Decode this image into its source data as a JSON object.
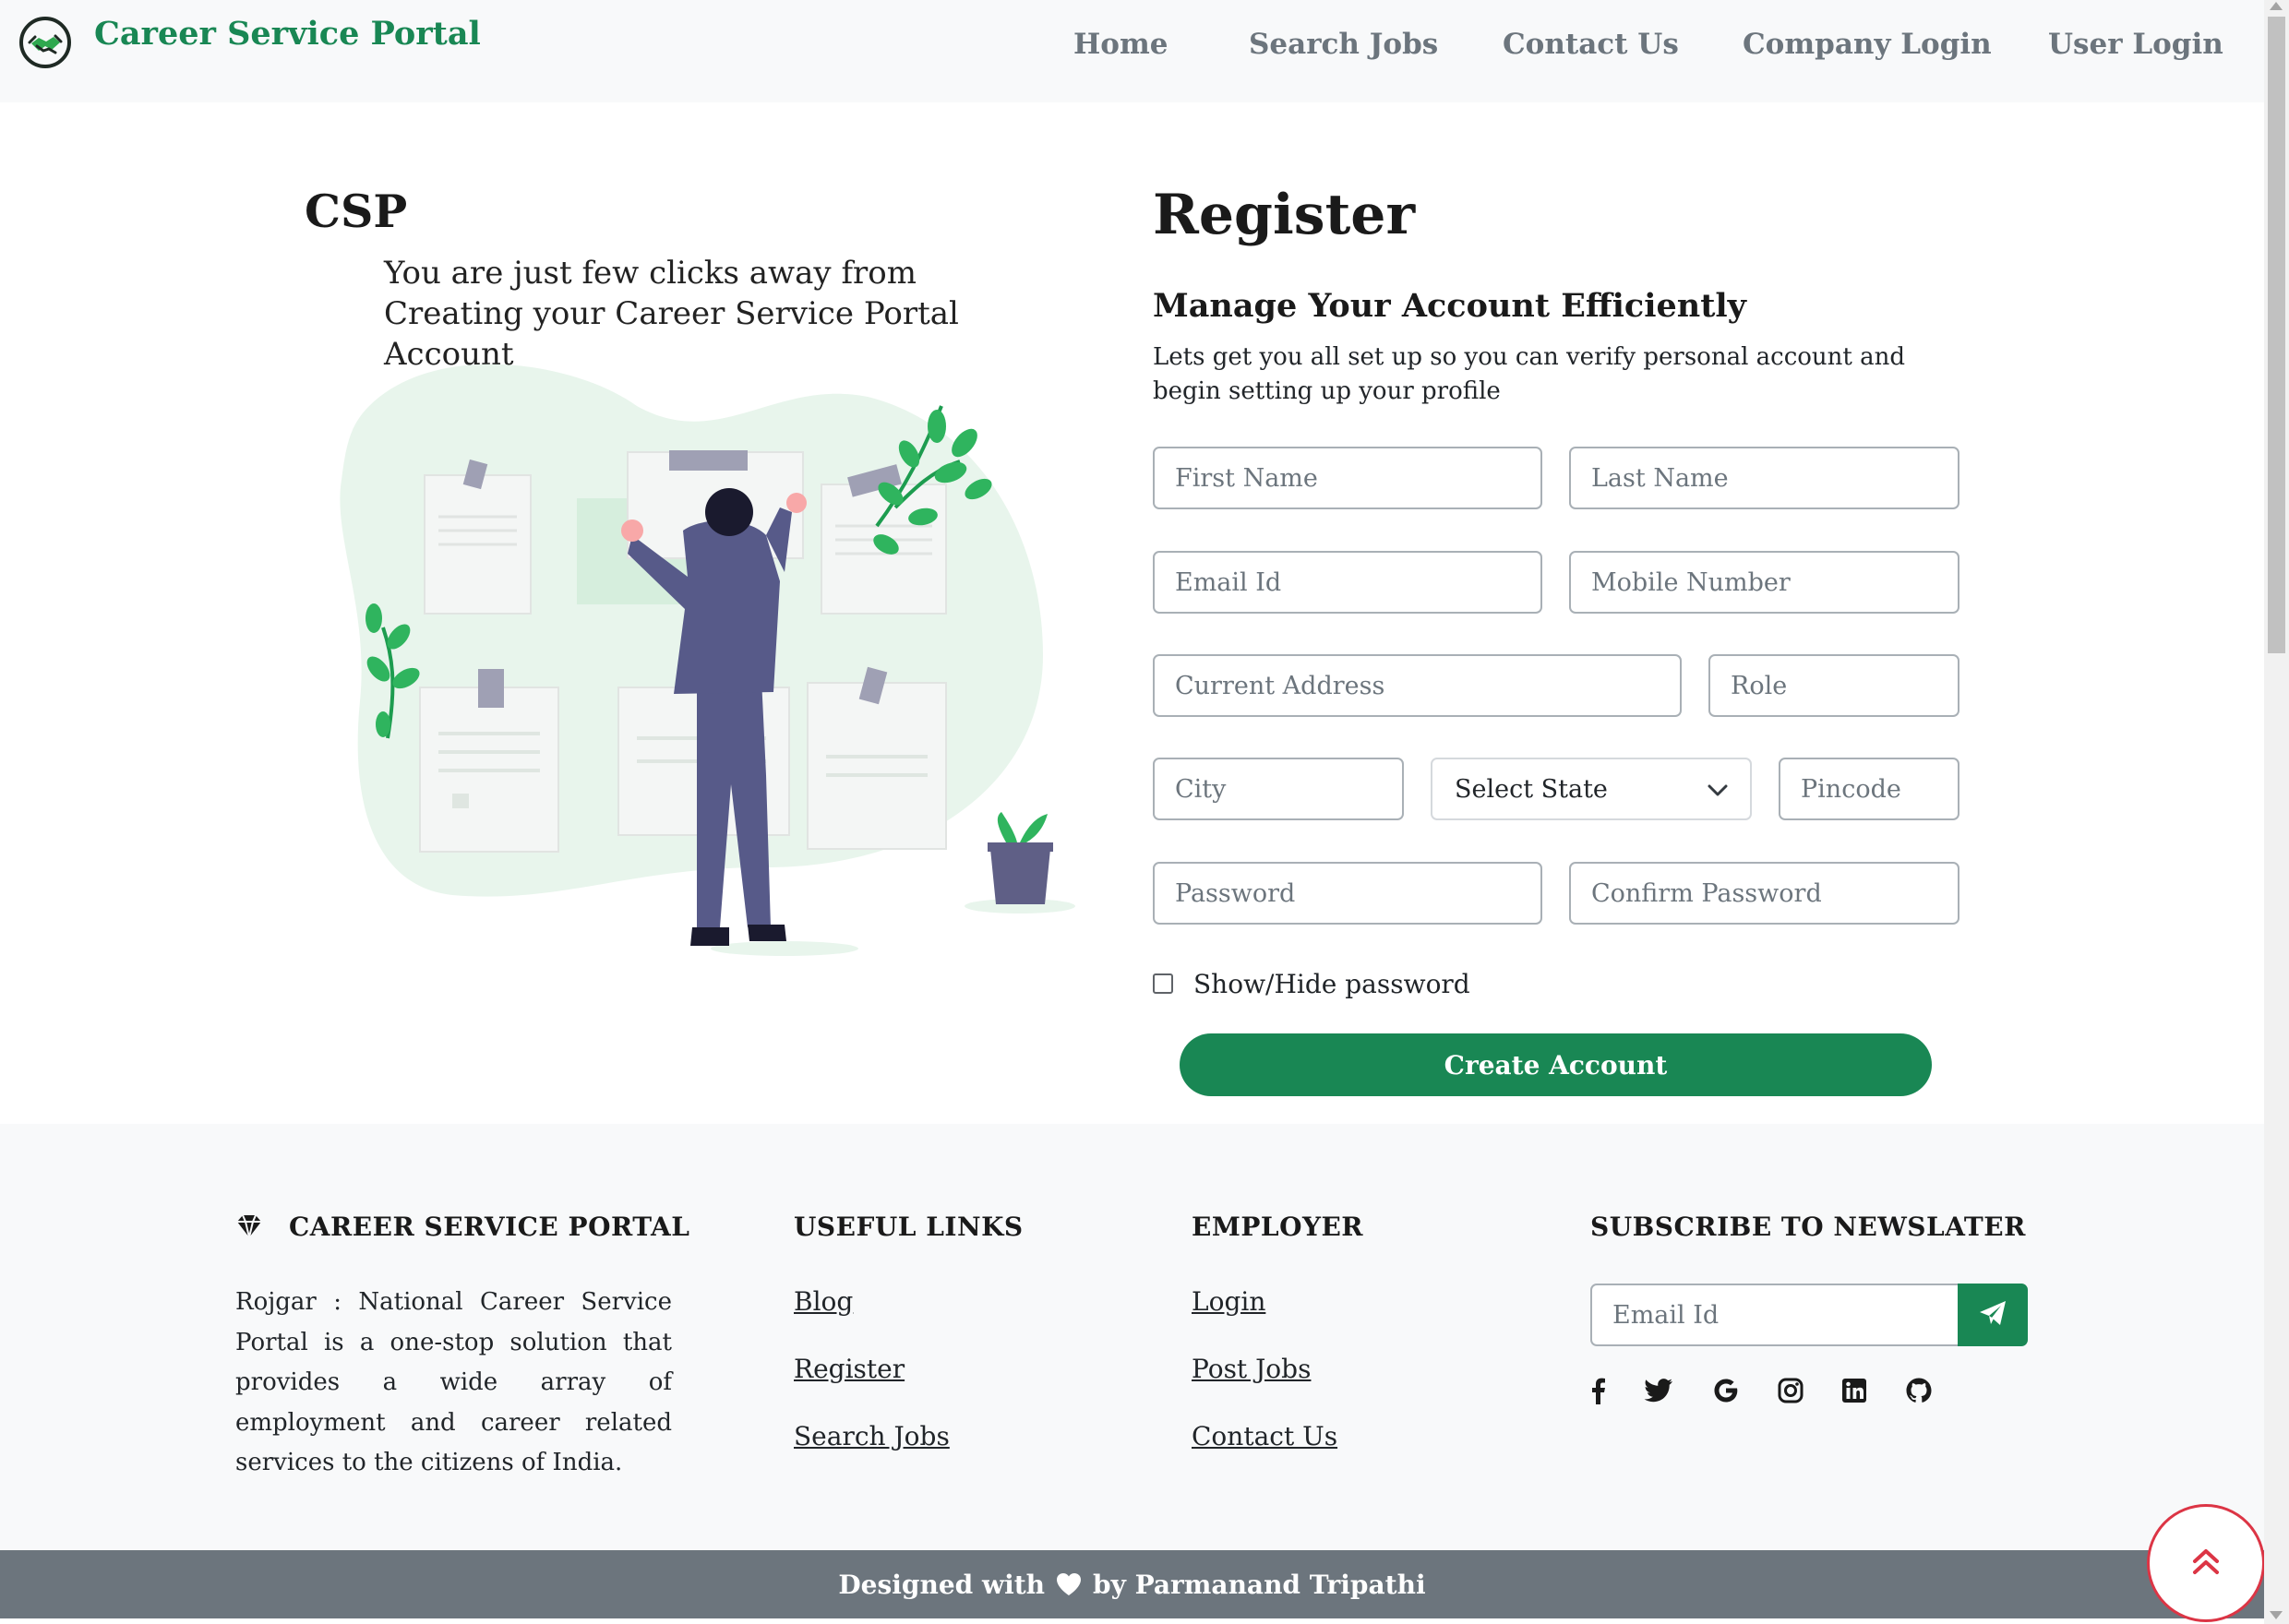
{
  "colors": {
    "brand": "#198754",
    "nav_text": "#6c757d",
    "footer_bg": "#f8f9fa",
    "bottom_bar": "#6c757d",
    "back_to_top": "#dc3545"
  },
  "navbar": {
    "brand": "Career Service Portal",
    "logo_icon": "handshake-icon",
    "links": [
      "Home",
      "Search Jobs",
      "Contact Us",
      "Company Login",
      "User Login"
    ]
  },
  "hero": {
    "title": "CSP",
    "tagline": "You are just few clicks away from Creating your Career Service Portal Account",
    "illustration_icon": "man-arranging-documents-illustration"
  },
  "register": {
    "title": "Register",
    "subtitle": "Manage Your Account Efficiently",
    "description": "Lets get you all set up so you can verify personal account and begin setting up your profile",
    "fields": {
      "first_name": "First Name",
      "last_name": "Last Name",
      "email": "Email Id",
      "mobile": "Mobile Number",
      "address": "Current Address",
      "role": "Role",
      "city": "City",
      "state": "Select State",
      "pincode": "Pincode",
      "password": "Password",
      "confirm_password": "Confirm Password"
    },
    "show_password_label": "Show/Hide password",
    "show_password_checked": false,
    "submit_label": "Create Account"
  },
  "footer": {
    "about": {
      "icon": "gem-icon",
      "heading": "CAREER SERVICE PORTAL",
      "text": "Rojgar : National Career Service Portal is a one-stop solution that provides a wide array of employment and career related services to the citizens of India."
    },
    "useful_links": {
      "heading": "USEFUL LINKS",
      "links": [
        "Blog",
        "Register",
        "Search Jobs"
      ]
    },
    "employer": {
      "heading": "EMPLOYER",
      "links": [
        "Login",
        "Post Jobs",
        "Contact Us"
      ]
    },
    "newsletter": {
      "heading": "SUBSCRIBE TO NEWSLATER",
      "placeholder": "Email Id",
      "submit_icon": "paper-plane-icon",
      "social_icons": [
        "facebook-icon",
        "twitter-icon",
        "google-icon",
        "instagram-icon",
        "linkedin-icon",
        "github-icon"
      ]
    }
  },
  "bottom_bar": {
    "prefix": "Designed with",
    "heart_icon": "heart-icon",
    "suffix": "by Parmanand Tripathi"
  },
  "back_to_top_icon": "double-chevron-up-icon"
}
